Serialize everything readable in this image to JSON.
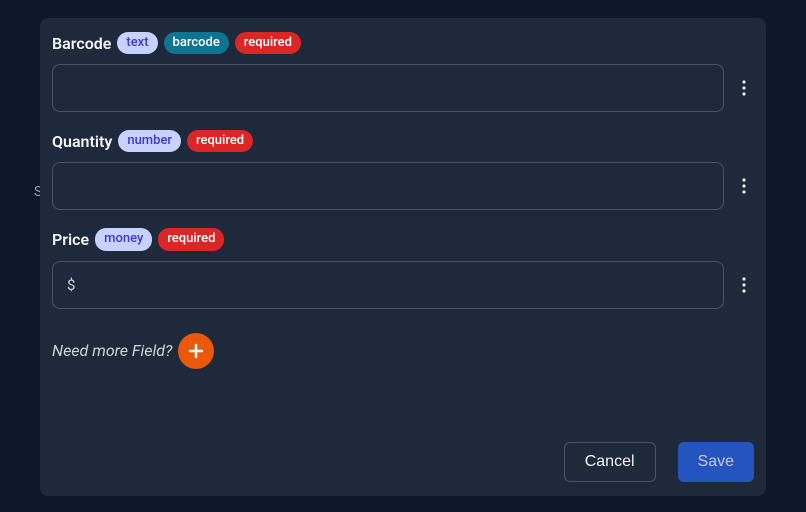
{
  "bg": {
    "letter": "S"
  },
  "fields": {
    "barcode": {
      "label": "Barcode",
      "badge_type": "text",
      "badge_extra": "barcode",
      "badge_required": "required",
      "value": ""
    },
    "quantity": {
      "label": "Quantity",
      "badge_type": "number",
      "badge_required": "required",
      "value": ""
    },
    "price": {
      "label": "Price",
      "badge_type": "money",
      "badge_required": "required",
      "prefix": "$",
      "value": ""
    }
  },
  "addField": {
    "prompt": "Need more Field?"
  },
  "footer": {
    "cancel": "Cancel",
    "save": "Save"
  }
}
